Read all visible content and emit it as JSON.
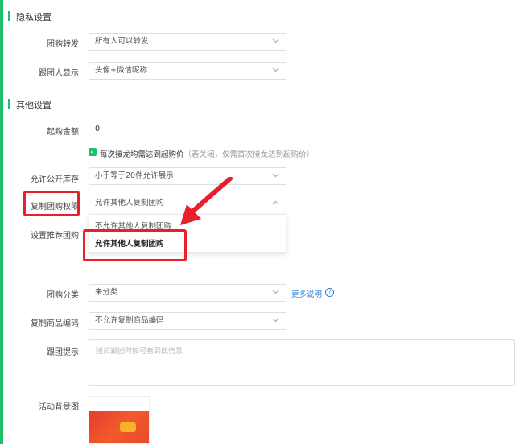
{
  "colors": {
    "accent": "#1fbf68",
    "highlight": "#e8202a",
    "link": "#2a7fd8"
  },
  "privacy": {
    "title": "隐私设置",
    "group_forward_label": "团购转发",
    "group_forward_value": "所有人可以转发",
    "follower_display_label": "跟团人显示",
    "follower_display_value": "头像+微信昵称"
  },
  "other": {
    "title": "其他设置",
    "min_amount_label": "起购金额",
    "min_amount_value": "0",
    "checkbox_text": "每次接龙均需达到起购价",
    "checkbox_note": "（若关闭，仅需首次接龙达到起购价）",
    "inventory_label": "允许公开库存",
    "inventory_value": "小于等于20件允许展示",
    "copy_perm_label": "复制团购权限",
    "copy_perm_value": "允许其他人复制团购",
    "copy_perm_options": [
      "不允许其他人复制团购",
      "允许其他人复制团购"
    ],
    "recommend_label": "设置推荐团购",
    "category_label": "团购分类",
    "category_value": "未分类",
    "more_info": "更多说明",
    "copy_code_label": "复制商品编码",
    "copy_code_value": "不允许复制商品编码",
    "follow_tip_label": "跟团提示",
    "follow_tip_placeholder": "团员跟团时候可看到此信息",
    "bg_image_label": "活动背景图"
  }
}
